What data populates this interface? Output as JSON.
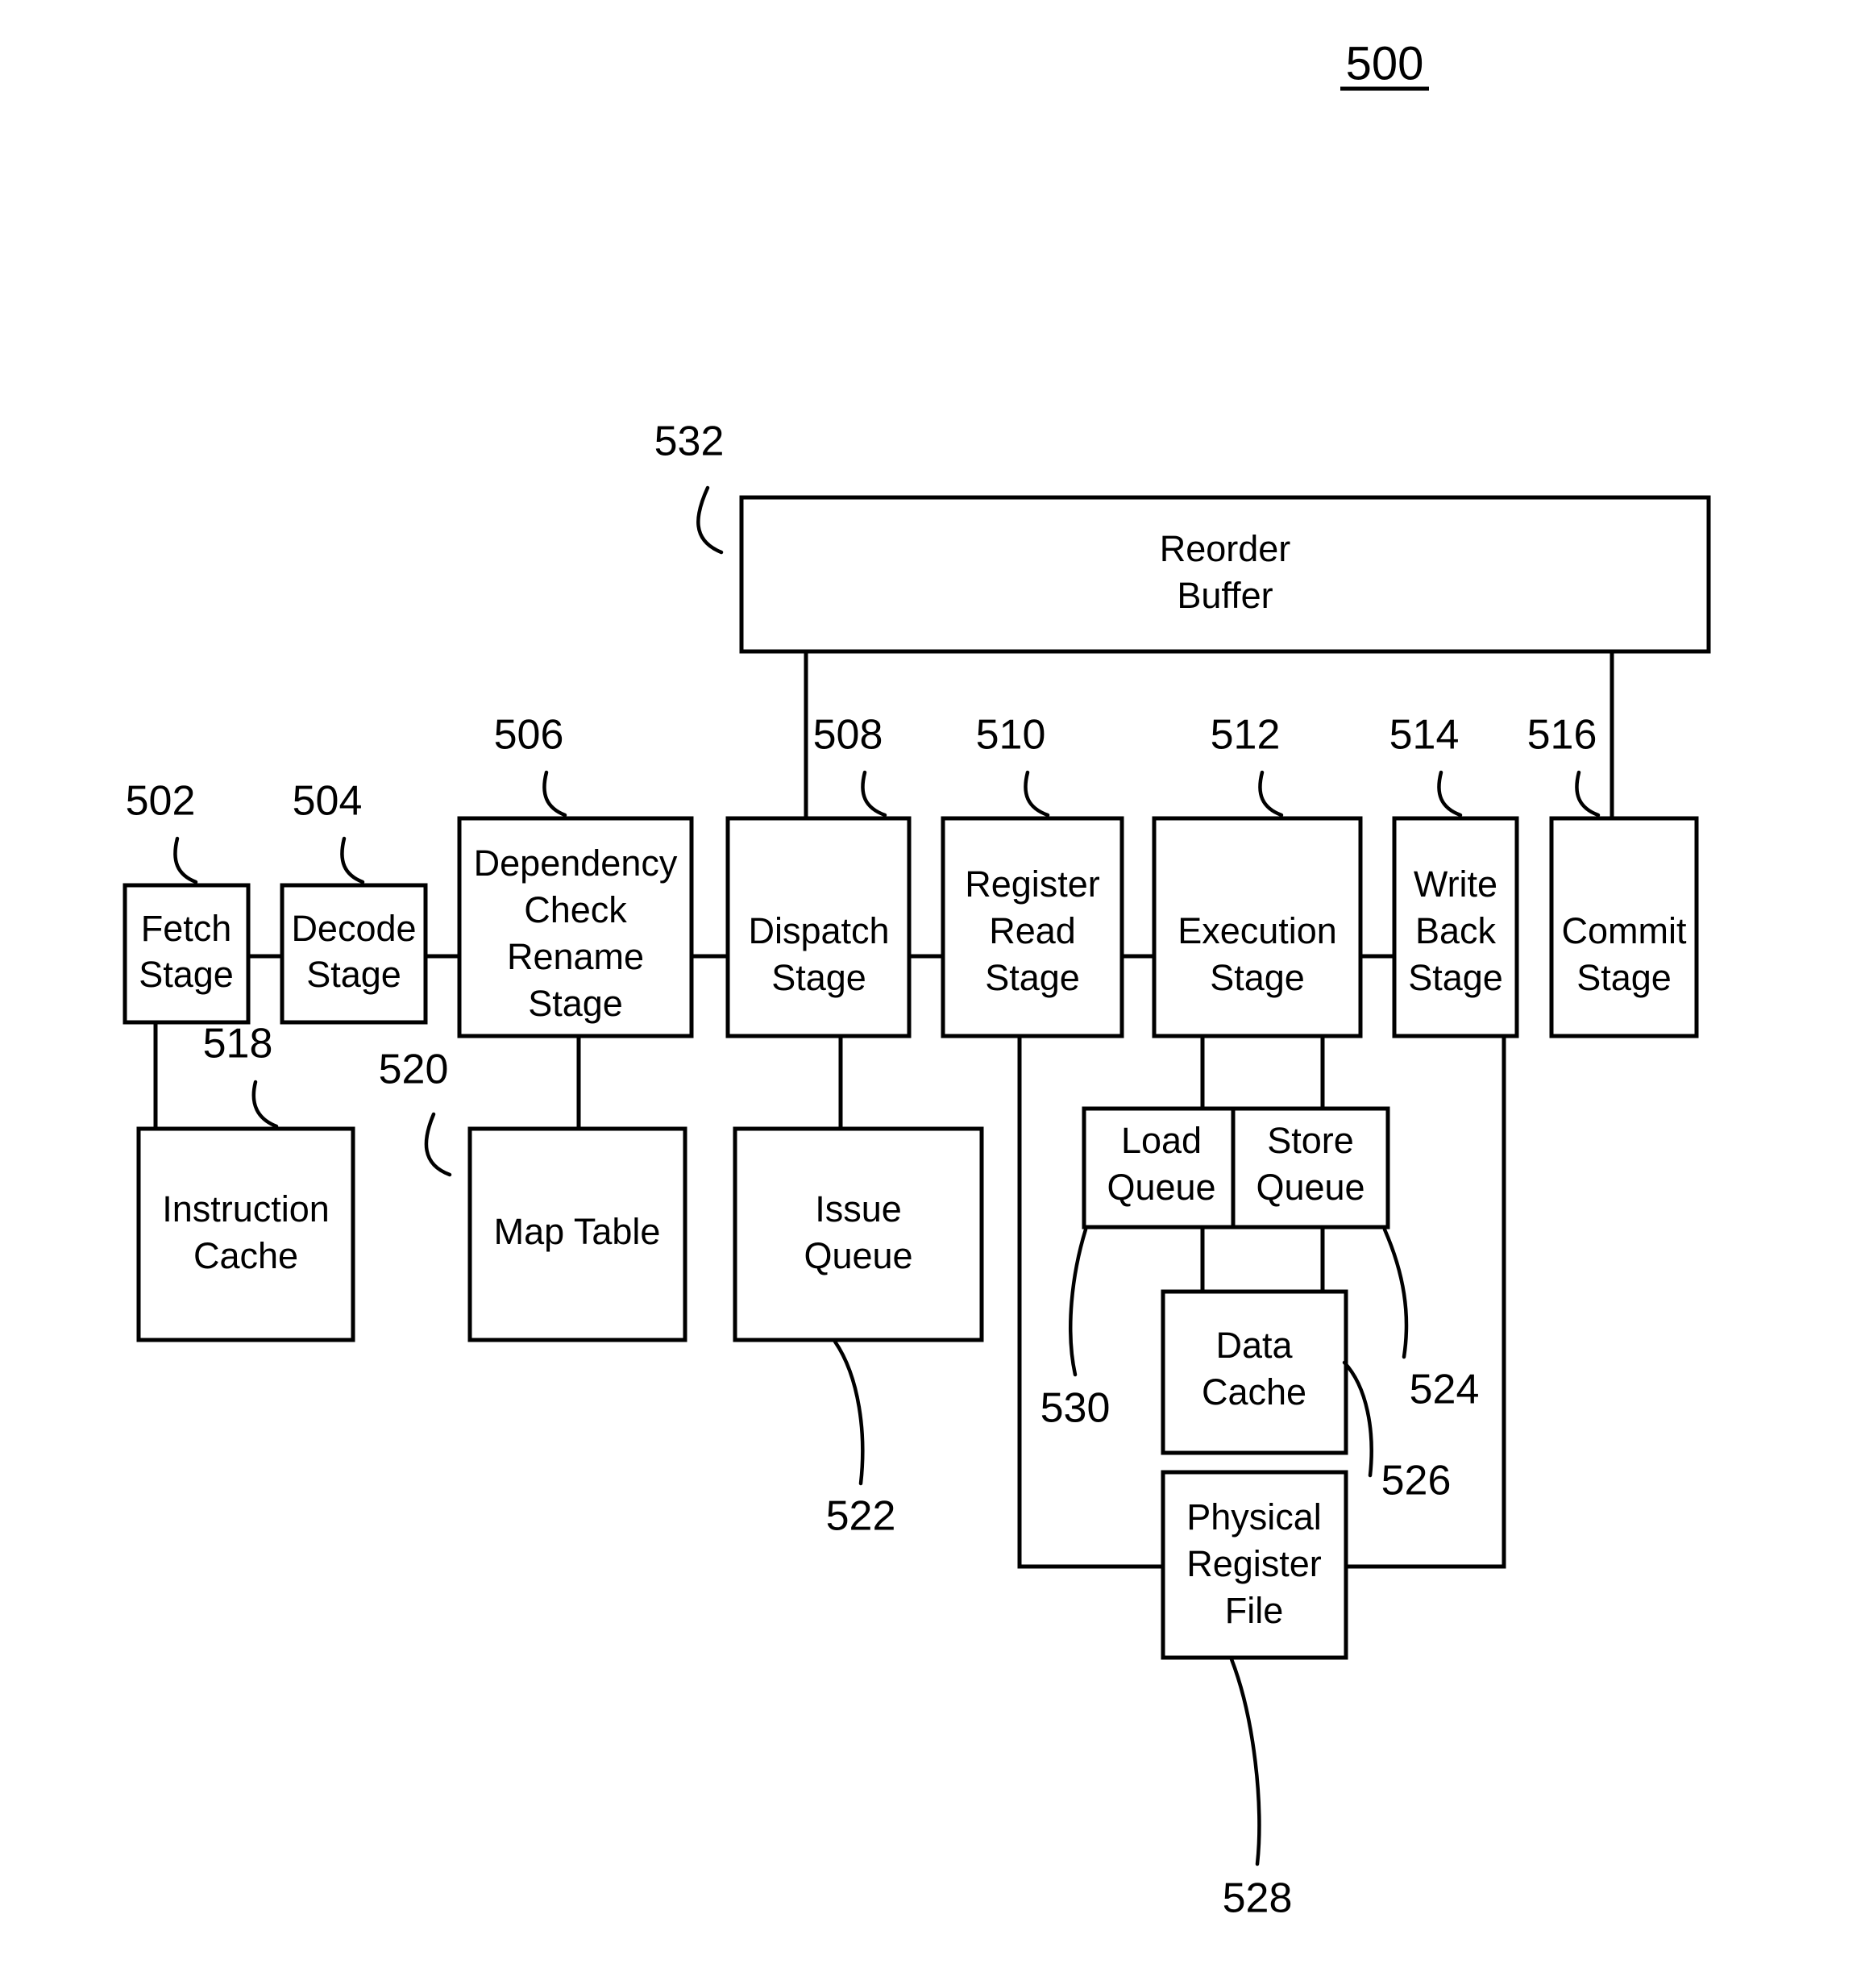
{
  "figure": {
    "number": "500",
    "kind": "processor-pipeline-block-diagram"
  },
  "blocks": [
    {
      "id": "reorder_buffer",
      "label_line1": "Reorder",
      "label_line2": "Buffer",
      "label_line3": "",
      "ref": "532"
    },
    {
      "id": "fetch_stage",
      "label_line1": "Fetch",
      "label_line2": "Stage",
      "label_line3": "",
      "ref": "502"
    },
    {
      "id": "decode_stage",
      "label_line1": "Decode",
      "label_line2": "Stage",
      "label_line3": "",
      "ref": "504"
    },
    {
      "id": "dep_check_rename",
      "label_line1": "Dependency",
      "label_line2": "Check",
      "label_line3": "Rename",
      "label_line4": "Stage",
      "ref": "506"
    },
    {
      "id": "dispatch_stage",
      "label_line1": "Dispatch",
      "label_line2": "Stage",
      "label_line3": "",
      "ref": "508"
    },
    {
      "id": "register_read",
      "label_line1": "Register",
      "label_line2": "Read",
      "label_line3": "Stage",
      "ref": "510"
    },
    {
      "id": "execution_stage",
      "label_line1": "Execution",
      "label_line2": "Stage",
      "label_line3": "",
      "ref": "512"
    },
    {
      "id": "write_back_stage",
      "label_line1": "Write",
      "label_line2": "Back",
      "label_line3": "Stage",
      "ref": "514"
    },
    {
      "id": "commit_stage",
      "label_line1": "Commit",
      "label_line2": "Stage",
      "label_line3": "",
      "ref": "516"
    },
    {
      "id": "instruction_cache",
      "label_line1": "Instruction",
      "label_line2": "Cache",
      "label_line3": "",
      "ref": "518"
    },
    {
      "id": "map_table",
      "label_line1": "Map Table",
      "label_line2": "",
      "label_line3": "",
      "ref": "520"
    },
    {
      "id": "issue_queue",
      "label_line1": "Issue",
      "label_line2": "Queue",
      "label_line3": "",
      "ref": "522"
    },
    {
      "id": "load_queue",
      "label_line1": "Load",
      "label_line2": "Queue",
      "label_line3": "",
      "ref": "530"
    },
    {
      "id": "store_queue",
      "label_line1": "Store",
      "label_line2": "Queue",
      "label_line3": "",
      "ref": "524"
    },
    {
      "id": "data_cache",
      "label_line1": "Data",
      "label_line2": "Cache",
      "label_line3": "",
      "ref": "526"
    },
    {
      "id": "phys_reg_file",
      "label_line1": "Physical",
      "label_line2": "Register",
      "label_line3": "File",
      "ref": "528"
    }
  ],
  "labels": {
    "reorder_buffer_l1": "Reorder",
    "reorder_buffer_l2": "Buffer",
    "fetch_l1": "Fetch",
    "fetch_l2": "Stage",
    "decode_l1": "Decode",
    "decode_l2": "Stage",
    "dep_l1": "Dependency",
    "dep_l2": "Check",
    "dep_l3": "Rename",
    "dep_l4": "Stage",
    "dispatch_l1": "Dispatch",
    "dispatch_l2": "Stage",
    "regread_l1": "Register",
    "regread_l2": "Read",
    "regread_l3": "Stage",
    "exec_l1": "Execution",
    "exec_l2": "Stage",
    "writeback_l1": "Write",
    "writeback_l2": "Back",
    "writeback_l3": "Stage",
    "commit_l1": "Commit",
    "commit_l2": "Stage",
    "icache_l1": "Instruction",
    "icache_l2": "Cache",
    "maptable_l1": "Map Table",
    "issueq_l1": "Issue",
    "issueq_l2": "Queue",
    "loadq_l1": "Load",
    "loadq_l2": "Queue",
    "storeq_l1": "Store",
    "storeq_l2": "Queue",
    "dcache_l1": "Data",
    "dcache_l2": "Cache",
    "prf_l1": "Physical",
    "prf_l2": "Register",
    "prf_l3": "File"
  },
  "refs": {
    "figure": "500",
    "fetch": "502",
    "decode": "504",
    "dep_check_rename": "506",
    "dispatch": "508",
    "register_read": "510",
    "execution": "512",
    "write_back": "514",
    "commit": "516",
    "instruction_cache": "518",
    "map_table": "520",
    "issue_queue": "522",
    "store_queue": "524",
    "data_cache": "526",
    "phys_reg_file": "528",
    "load_queue": "530",
    "reorder_buffer": "532"
  },
  "colors": {
    "stroke": "#000000",
    "fill": "#ffffff"
  }
}
